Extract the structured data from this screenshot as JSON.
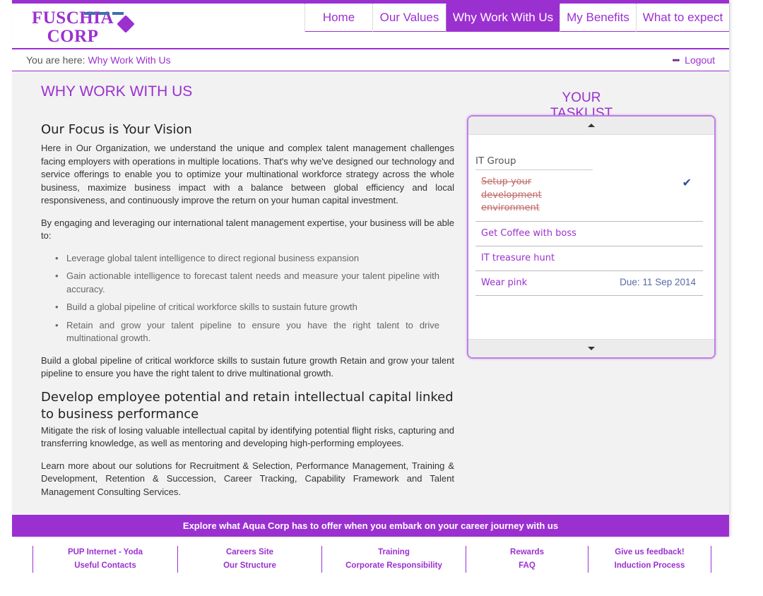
{
  "brand": {
    "line1": "FUSCHIA",
    "line2": "CORP",
    "accent": "#9b30d0"
  },
  "nav": {
    "items": [
      {
        "label": "Home"
      },
      {
        "label": "Our Values"
      },
      {
        "label": "Why Work With Us",
        "active": true
      },
      {
        "label": "My Benefits"
      },
      {
        "label": "What to expect"
      }
    ]
  },
  "breadcrumb": {
    "prefix": "You are here:",
    "current": "Why Work With Us"
  },
  "user_menu": {
    "dots_icon": "more-icon",
    "logout": "Logout"
  },
  "main": {
    "title": "WHY WORK WITH US",
    "h1": "Our Focus is Your Vision",
    "p1": "Here in Our Organization, we understand the unique and complex talent management challenges facing employers with operations in multiple locations. That's why we've designed our technology and service offerings to enable you to optimize your multinational workforce strategy across the whole business, maximize business impact with a balance between global efficiency and local responsiveness, and continuously improve the return on your human capital investment.",
    "p2": "By engaging and leveraging our international talent management expertise, your business will be able to:",
    "bullets": [
      "Leverage global talent intelligence to direct regional business expansion",
      "Gain actionable intelligence to forecast talent needs and measure your talent pipeline with accuracy.",
      "Build a global pipeline of critical workforce skills to sustain future growth",
      "Retain and grow your talent pipeline to ensure you have the right talent to drive multinational growth."
    ],
    "p3": "Build a global pipeline of critical workforce skills to sustain future growth Retain and grow your talent pipeline to ensure you have the right talent to drive multinational growth.",
    "h2": "Develop employee potential and retain intellectual capital linked to business performance",
    "p4": "Mitigate the risk of losing valuable intellectual capital by identifying potential flight risks, capturing and transferring knowledge, as well as mentoring and developing high-performing employees.",
    "p5": "Learn more about our solutions for Recruitment & Selection, Performance Management, Training & Development, Retention & Succession, Career Tracking, Capability Framework and Talent Management Consulting Services."
  },
  "tasklist": {
    "title": "YOUR TASKLIST",
    "group": "IT Group",
    "tasks": [
      {
        "name": "Setup your development environment",
        "done": true,
        "icon": "check-icon"
      },
      {
        "name": "Get Coffee with boss"
      },
      {
        "name": "IT treasure hunt"
      },
      {
        "name": "Wear pink",
        "due": "Due: 11 Sep 2014"
      }
    ]
  },
  "footer": {
    "banner": "Explore what Aqua Corp has to offer when you embark on your career journey with us",
    "columns": [
      [
        "PUP Internet - Yoda",
        "Useful Contacts"
      ],
      [
        "Careers Site",
        "Our Structure"
      ],
      [
        "Training",
        "Corporate Responsibility"
      ],
      [
        "Rewards",
        "FAQ"
      ],
      [
        "Give us feedback!",
        "Induction Process"
      ]
    ]
  }
}
